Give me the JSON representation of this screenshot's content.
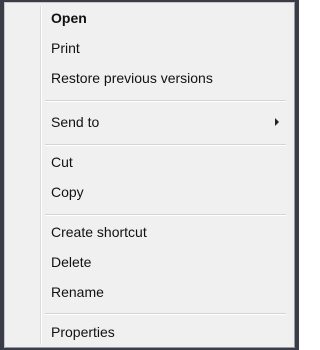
{
  "context_menu": {
    "items": [
      {
        "label": "Open"
      },
      {
        "label": "Print"
      },
      {
        "label": "Restore previous versions"
      },
      {
        "label": "Send to",
        "has_submenu": true,
        "submenu_arrow": "chevron-right-icon"
      },
      {
        "label": "Cut"
      },
      {
        "label": "Copy"
      },
      {
        "label": "Create shortcut"
      },
      {
        "label": "Delete"
      },
      {
        "label": "Rename"
      },
      {
        "label": "Properties"
      }
    ]
  }
}
